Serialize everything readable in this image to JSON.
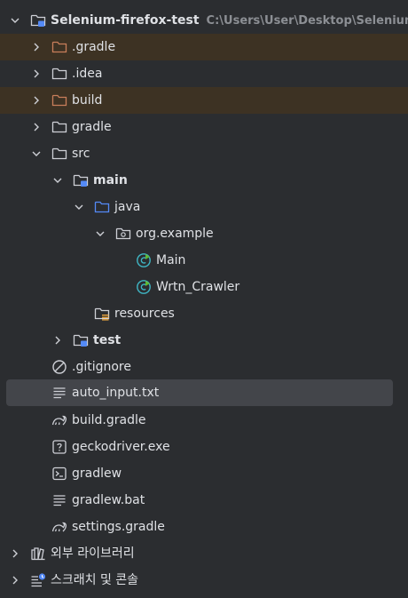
{
  "tree": {
    "root": {
      "label": "Selenium-firefox-test",
      "path": "C:\\Users\\User\\Desktop\\Selenium"
    },
    "items": [
      {
        "label": ".gradle",
        "icon": "folder-excluded-icon"
      },
      {
        "label": ".idea",
        "icon": "folder-icon"
      },
      {
        "label": "build",
        "icon": "folder-excluded-icon"
      },
      {
        "label": "gradle",
        "icon": "folder-icon"
      },
      {
        "label": "src",
        "icon": "folder-icon"
      },
      {
        "label": "main",
        "icon": "module-folder-icon"
      },
      {
        "label": "java",
        "icon": "source-folder-icon"
      },
      {
        "label": "org.example",
        "icon": "package-icon"
      },
      {
        "label": "Main",
        "icon": "java-class-main-icon"
      },
      {
        "label": "Wrtn_Crawler",
        "icon": "java-class-main-icon"
      },
      {
        "label": "resources",
        "icon": "resources-folder-icon"
      },
      {
        "label": "test",
        "icon": "module-folder-icon"
      },
      {
        "label": ".gitignore",
        "icon": "gitignore-icon"
      },
      {
        "label": "auto_input.txt",
        "icon": "text-file-icon"
      },
      {
        "label": "build.gradle",
        "icon": "gradle-icon"
      },
      {
        "label": "geckodriver.exe",
        "icon": "unknown-file-icon"
      },
      {
        "label": "gradlew",
        "icon": "terminal-script-icon"
      },
      {
        "label": "gradlew.bat",
        "icon": "text-file-icon"
      },
      {
        "label": "settings.gradle",
        "icon": "gradle-icon"
      }
    ],
    "external_libraries": "외부 라이브러리",
    "scratches": "스크래치 및 콘솔"
  },
  "colors": {
    "background": "#2b2d30",
    "selection": "#43454a",
    "excluded_row": "#3d3223",
    "excluded_folder": "#c87e5a",
    "folder": "#ced0d6",
    "source_blue": "#548af7",
    "class_teal": "#3fb6c5"
  }
}
